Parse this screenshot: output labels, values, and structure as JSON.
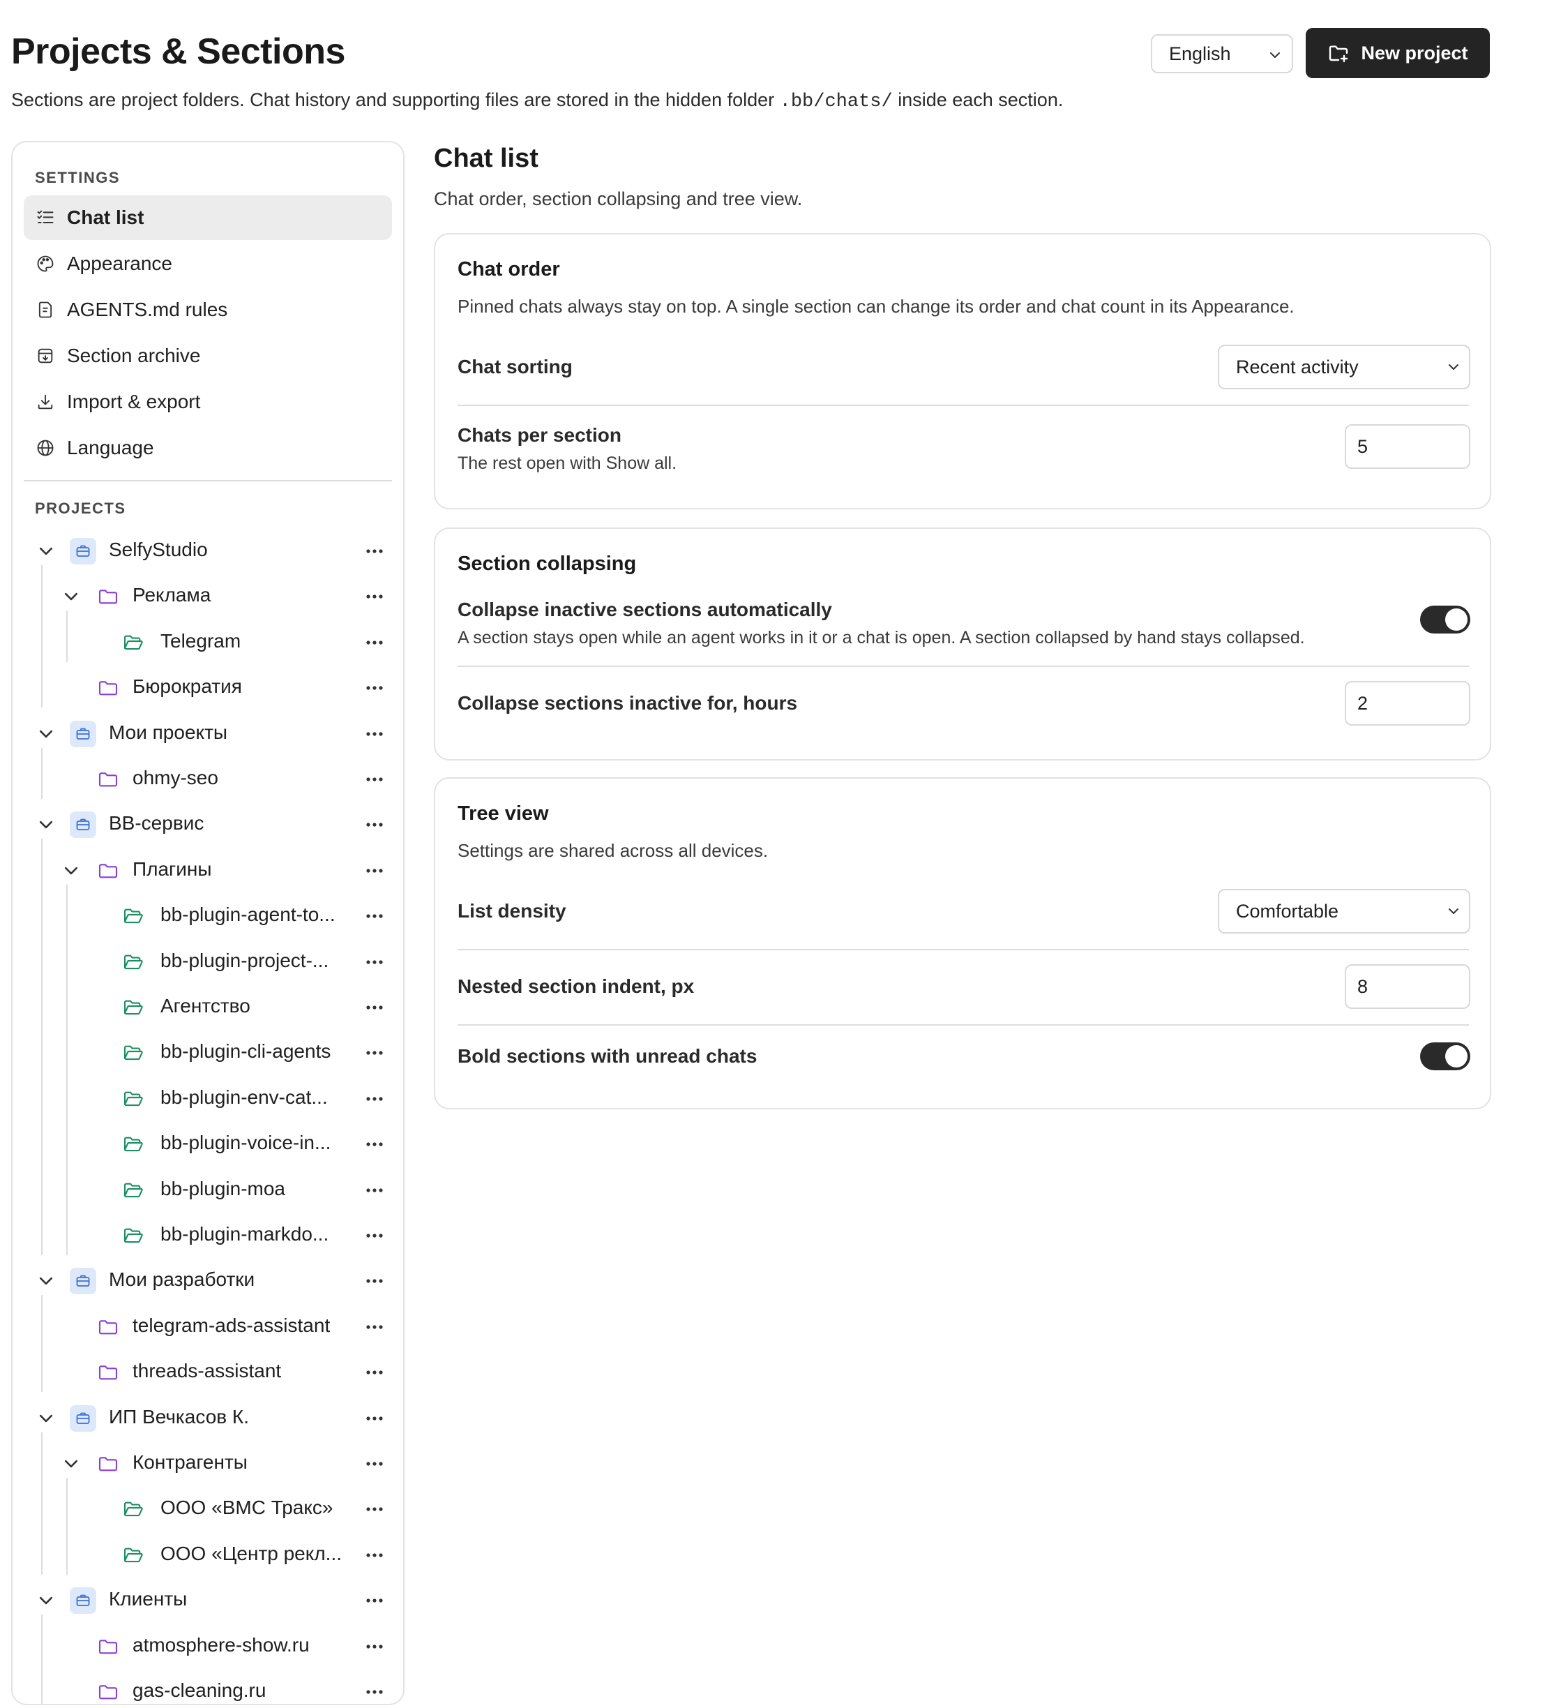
{
  "header": {
    "title": "Projects & Sections",
    "subtitle_before": "Sections are project folders. Chat history and supporting files are stored in the hidden folder",
    "subtitle_code": ".bb/chats/",
    "subtitle_after": "inside each section.",
    "language": "English",
    "new_project_label": "New project"
  },
  "sidebar": {
    "settings_heading": "SETTINGS",
    "settings_items": [
      {
        "label": "Chat list",
        "icon": "list-checks-icon",
        "active": true
      },
      {
        "label": "Appearance",
        "icon": "palette-icon"
      },
      {
        "label": "AGENTS.md rules",
        "icon": "document-icon"
      },
      {
        "label": "Section archive",
        "icon": "archive-icon"
      },
      {
        "label": "Import & export",
        "icon": "download-icon"
      },
      {
        "label": "Language",
        "icon": "globe-icon"
      }
    ],
    "projects_heading": "PROJECTS",
    "tree": [
      {
        "label": "SelfyStudio",
        "type": "project",
        "level": 0,
        "expanded": true
      },
      {
        "label": "Реклама",
        "type": "folder",
        "level": 1,
        "expanded": true
      },
      {
        "label": "Telegram",
        "type": "open-folder",
        "level": 2
      },
      {
        "label": "Бюрократия",
        "type": "folder",
        "level": 1
      },
      {
        "label": "Мои проекты",
        "type": "project",
        "level": 0,
        "expanded": true
      },
      {
        "label": "ohmy-seo",
        "type": "folder",
        "level": 1
      },
      {
        "label": "BB-сервис",
        "type": "project",
        "level": 0,
        "expanded": true
      },
      {
        "label": "Плагины",
        "type": "folder",
        "level": 1,
        "expanded": true
      },
      {
        "label": "bb-plugin-agent-to...",
        "type": "open-folder",
        "level": 2
      },
      {
        "label": "bb-plugin-project-...",
        "type": "open-folder",
        "level": 2
      },
      {
        "label": "Агентство",
        "type": "open-folder",
        "level": 2
      },
      {
        "label": "bb-plugin-cli-agents",
        "type": "open-folder",
        "level": 2
      },
      {
        "label": "bb-plugin-env-cat...",
        "type": "open-folder",
        "level": 2
      },
      {
        "label": "bb-plugin-voice-in...",
        "type": "open-folder",
        "level": 2
      },
      {
        "label": "bb-plugin-moa",
        "type": "open-folder",
        "level": 2
      },
      {
        "label": "bb-plugin-markdo...",
        "type": "open-folder",
        "level": 2
      },
      {
        "label": "Мои разработки",
        "type": "project",
        "level": 0,
        "expanded": true
      },
      {
        "label": "telegram-ads-assistant",
        "type": "folder",
        "level": 1
      },
      {
        "label": "threads-assistant",
        "type": "folder",
        "level": 1
      },
      {
        "label": "ИП Вечкасов К.",
        "type": "project",
        "level": 0,
        "expanded": true
      },
      {
        "label": "Контрагенты",
        "type": "folder",
        "level": 1,
        "expanded": true
      },
      {
        "label": "ООО «ВМС Тракс»",
        "type": "open-folder",
        "level": 2
      },
      {
        "label": "ООО «Центр рекл...",
        "type": "open-folder",
        "level": 2
      },
      {
        "label": "Клиенты",
        "type": "project",
        "level": 0,
        "expanded": true
      },
      {
        "label": "atmosphere-show.ru",
        "type": "folder",
        "level": 1
      },
      {
        "label": "gas-cleaning.ru",
        "type": "folder",
        "level": 1
      }
    ]
  },
  "main": {
    "title": "Chat list",
    "subtitle": "Chat order, section collapsing and tree view.",
    "chat_order": {
      "title": "Chat order",
      "description": "Pinned chats always stay on top. A single section can change its order and chat count in its Appearance.",
      "sorting_label": "Chat sorting",
      "sorting_value": "Recent activity",
      "per_section_label": "Chats per section",
      "per_section_hint": "The rest open with Show all.",
      "per_section_value": "5"
    },
    "section_collapsing": {
      "title": "Section collapsing",
      "auto_label": "Collapse inactive sections automatically",
      "auto_hint": "A section stays open while an agent works in it or a chat is open. A section collapsed by hand stays collapsed.",
      "auto_on": true,
      "hours_label": "Collapse sections inactive for, hours",
      "hours_value": "2"
    },
    "tree_view": {
      "title": "Tree view",
      "description": "Settings are shared across all devices.",
      "density_label": "List density",
      "density_value": "Comfortable",
      "indent_label": "Nested section indent, px",
      "indent_value": "8",
      "bold_label": "Bold sections with unread chats",
      "bold_on": true
    }
  },
  "colors": {
    "project_icon": "#3b6fd9",
    "project_badge": "#dde8fb",
    "folder_icon": "#8a3fd1",
    "open_folder_icon": "#1e8f62",
    "primary_button": "#242424"
  }
}
